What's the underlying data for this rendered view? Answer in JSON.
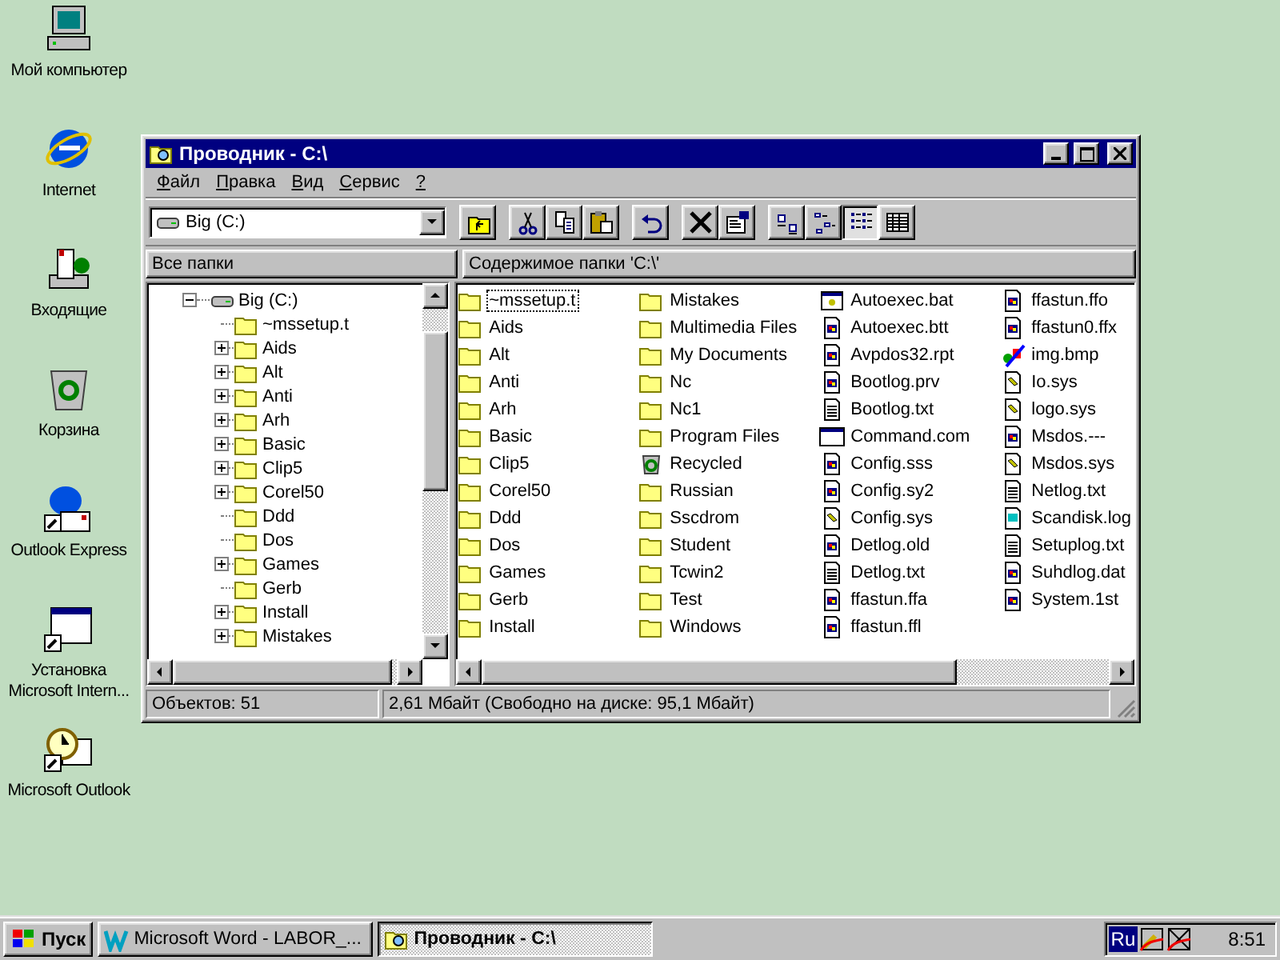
{
  "desktop_icons": [
    {
      "label": "Мой компьютер",
      "kind": "computer"
    },
    {
      "label": "Internet",
      "kind": "browser"
    },
    {
      "label": "Входящие",
      "kind": "inbox"
    },
    {
      "label": "Корзина",
      "kind": "recycle"
    },
    {
      "label": "Outlook Express",
      "kind": "mail"
    },
    {
      "label": "Установка Microsoft Intern...",
      "kind": "setup"
    },
    {
      "label": "Microsoft Outlook",
      "kind": "outlook"
    }
  ],
  "window": {
    "title": "Проводник - C:\\",
    "menu": [
      "Файл",
      "Правка",
      "Вид",
      "Сервис",
      "?"
    ],
    "drive": "Big (C:)",
    "toolbar_groups": [
      [
        {
          "kind": "up",
          "selected": false
        }
      ],
      [
        {
          "kind": "cut",
          "selected": false
        },
        {
          "kind": "copy",
          "selected": false
        },
        {
          "kind": "paste",
          "selected": false
        }
      ],
      [
        {
          "kind": "undo",
          "selected": false
        }
      ],
      [
        {
          "kind": "delete",
          "selected": false
        },
        {
          "kind": "properties",
          "selected": false
        }
      ],
      [
        {
          "kind": "large_icons",
          "selected": false
        },
        {
          "kind": "small_icons",
          "selected": false
        },
        {
          "kind": "list",
          "selected": true
        },
        {
          "kind": "details",
          "selected": false
        }
      ]
    ],
    "left_header": "Все папки",
    "right_header": "Содержимое папки 'C:\\'",
    "tree": {
      "label": "Big (C:)",
      "expanded": true,
      "children": [
        {
          "label": "~mssetup.t",
          "expandable": false
        },
        {
          "label": "Aids",
          "expandable": true
        },
        {
          "label": "Alt",
          "expandable": true
        },
        {
          "label": "Anti",
          "expandable": true
        },
        {
          "label": "Arh",
          "expandable": true
        },
        {
          "label": "Basic",
          "expandable": true
        },
        {
          "label": "Clip5",
          "expandable": true
        },
        {
          "label": "Corel50",
          "expandable": true
        },
        {
          "label": "Ddd",
          "expandable": false
        },
        {
          "label": "Dos",
          "expandable": false
        },
        {
          "label": "Games",
          "expandable": true
        },
        {
          "label": "Gerb",
          "expandable": false
        },
        {
          "label": "Install",
          "expandable": true
        },
        {
          "label": "Mistakes",
          "expandable": true
        }
      ]
    },
    "files": [
      {
        "name": "~mssetup.t",
        "kind": "folder",
        "selected": true
      },
      {
        "name": "Aids",
        "kind": "folder",
        "selected": false
      },
      {
        "name": "Alt",
        "kind": "folder",
        "selected": false
      },
      {
        "name": "Anti",
        "kind": "folder",
        "selected": false
      },
      {
        "name": "Arh",
        "kind": "folder",
        "selected": false
      },
      {
        "name": "Basic",
        "kind": "folder",
        "selected": false
      },
      {
        "name": "Clip5",
        "kind": "folder",
        "selected": false
      },
      {
        "name": "Corel50",
        "kind": "folder",
        "selected": false
      },
      {
        "name": "Ddd",
        "kind": "folder",
        "selected": false
      },
      {
        "name": "Dos",
        "kind": "folder",
        "selected": false
      },
      {
        "name": "Games",
        "kind": "folder",
        "selected": false
      },
      {
        "name": "Gerb",
        "kind": "folder",
        "selected": false
      },
      {
        "name": "Install",
        "kind": "folder",
        "selected": false
      },
      {
        "name": "Mistakes",
        "kind": "folder",
        "selected": false
      },
      {
        "name": "Multimedia Files",
        "kind": "folder",
        "selected": false
      },
      {
        "name": "My Documents",
        "kind": "folder",
        "selected": false
      },
      {
        "name": "Nc",
        "kind": "folder",
        "selected": false
      },
      {
        "name": "Nc1",
        "kind": "folder",
        "selected": false
      },
      {
        "name": "Program Files",
        "kind": "folder",
        "selected": false
      },
      {
        "name": "Recycled",
        "kind": "recycle",
        "selected": false
      },
      {
        "name": "Russian",
        "kind": "folder",
        "selected": false
      },
      {
        "name": "Sscdrom",
        "kind": "folder",
        "selected": false
      },
      {
        "name": "Student",
        "kind": "folder",
        "selected": false
      },
      {
        "name": "Tcwin2",
        "kind": "folder",
        "selected": false
      },
      {
        "name": "Test",
        "kind": "folder",
        "selected": false
      },
      {
        "name": "Windows",
        "kind": "folder",
        "selected": false
      },
      {
        "name": "Autoexec.bat",
        "kind": "batch",
        "selected": false
      },
      {
        "name": "Autoexec.btt",
        "kind": "file",
        "selected": false
      },
      {
        "name": "Avpdos32.rpt",
        "kind": "file",
        "selected": false
      },
      {
        "name": "Bootlog.prv",
        "kind": "file",
        "selected": false
      },
      {
        "name": "Bootlog.txt",
        "kind": "text",
        "selected": false
      },
      {
        "name": "Command.com",
        "kind": "program",
        "selected": false
      },
      {
        "name": "Config.sss",
        "kind": "file",
        "selected": false
      },
      {
        "name": "Config.sy2",
        "kind": "file",
        "selected": false
      },
      {
        "name": "Config.sys",
        "kind": "system",
        "selected": false
      },
      {
        "name": "Detlog.old",
        "kind": "file",
        "selected": false
      },
      {
        "name": "Detlog.txt",
        "kind": "text",
        "selected": false
      },
      {
        "name": "ffastun.ffa",
        "kind": "file",
        "selected": false
      },
      {
        "name": "ffastun.ffl",
        "kind": "file",
        "selected": false
      },
      {
        "name": "ffastun.ffo",
        "kind": "file",
        "selected": false
      },
      {
        "name": "ffastun0.ffx",
        "kind": "file",
        "selected": false
      },
      {
        "name": "img.bmp",
        "kind": "image",
        "selected": false
      },
      {
        "name": "Io.sys",
        "kind": "system",
        "selected": false
      },
      {
        "name": "logo.sys",
        "kind": "system",
        "selected": false
      },
      {
        "name": "Msdos.---",
        "kind": "file",
        "selected": false
      },
      {
        "name": "Msdos.sys",
        "kind": "system",
        "selected": false
      },
      {
        "name": "Netlog.txt",
        "kind": "text",
        "selected": false
      },
      {
        "name": "Scandisk.log",
        "kind": "log",
        "selected": false
      },
      {
        "name": "Setuplog.txt",
        "kind": "text",
        "selected": false
      },
      {
        "name": "Suhdlog.dat",
        "kind": "file",
        "selected": false
      },
      {
        "name": "System.1st",
        "kind": "file",
        "selected": false
      }
    ],
    "status": [
      "Объектов: 51",
      "2,61 Мбайт (Свободно на диске: 95,1 Мбайт)"
    ]
  },
  "taskbar": {
    "start": "Пуск",
    "tasks": [
      {
        "label": "Microsoft Word - LABOR_...",
        "kind": "word",
        "selected": false
      },
      {
        "label": "Проводник - C:\\",
        "kind": "explorer",
        "selected": true
      }
    ],
    "language": "Ru",
    "clock": "8:51"
  }
}
